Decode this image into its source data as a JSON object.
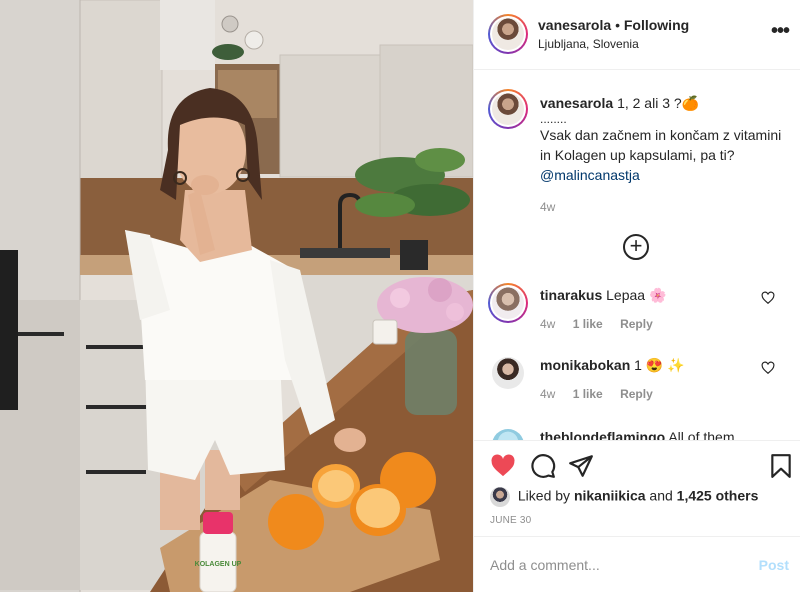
{
  "post": {
    "username": "vanesarola",
    "follow_status": "Following",
    "location": "Ljubljana, Slovenia"
  },
  "caption": {
    "username": "vanesarola",
    "text_line1": "1, 2 ali 3 ?🍊",
    "text_line2": "........",
    "text_line3": "Vsak dan začnem in končam z vitamini in Kolagen up kapsulami, pa ti?",
    "mention": "@malincanastja",
    "time": "4w"
  },
  "comments": [
    {
      "username": "tinarakus",
      "text": "Lepaa 🌸",
      "time": "4w",
      "likes": "1 like",
      "reply": "Reply"
    },
    {
      "username": "monikabokan",
      "text": "1 😍 ✨",
      "time": "4w",
      "likes": "1 like",
      "reply": "Reply"
    },
    {
      "username": "theblondeflamingo",
      "text": "All of them"
    }
  ],
  "likes": {
    "prefix": "Liked by",
    "user": "nikaniikica",
    "and": "and",
    "others": "1,425 others"
  },
  "date": "JUNE 30",
  "add_comment": {
    "placeholder": "Add a comment...",
    "post_label": "Post"
  },
  "product_label": "KOLAGEN UP",
  "icons": {
    "more": "more-options-icon",
    "load_more": "plus-circle-icon",
    "like": "heart-icon",
    "comment": "comment-icon",
    "share": "paper-plane-icon",
    "save": "bookmark-icon"
  },
  "colors": {
    "like_red": "#ed4956",
    "link_blue": "#00376b",
    "post_disabled": "#b2dffc"
  }
}
